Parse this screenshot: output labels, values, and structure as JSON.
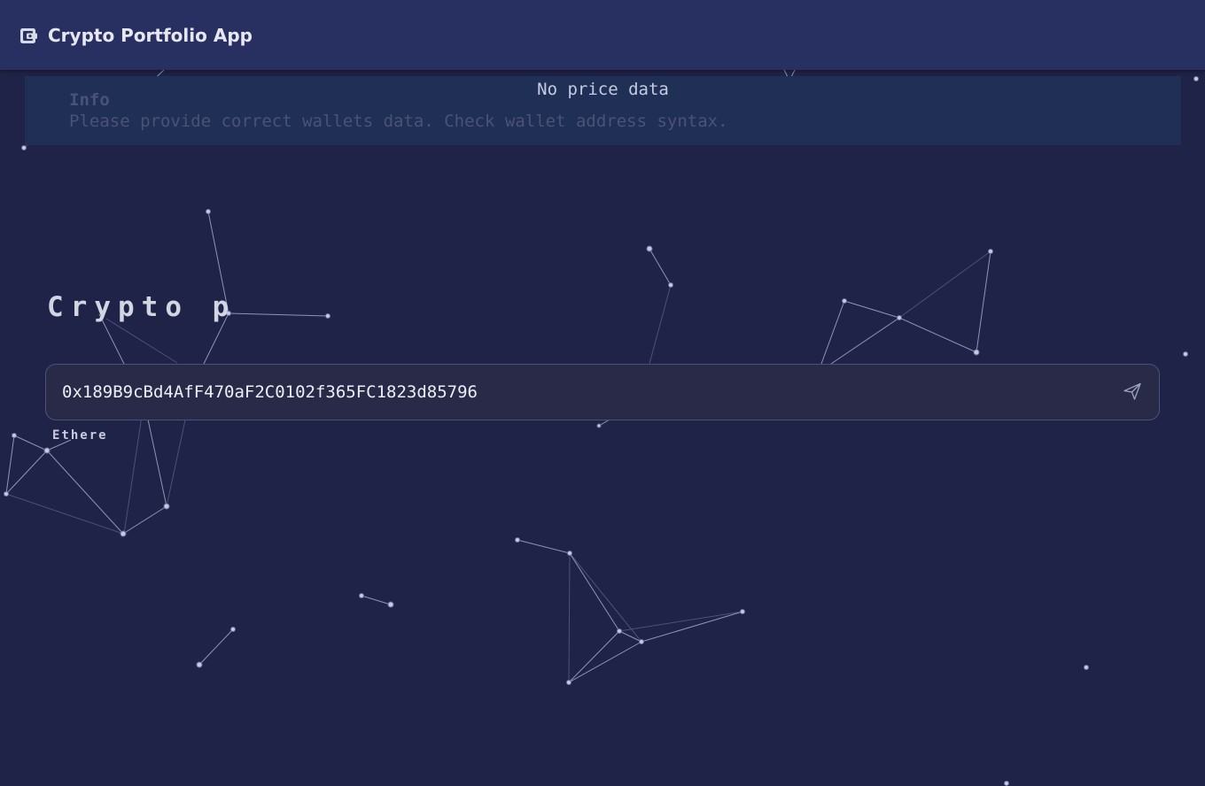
{
  "app_bar": {
    "icon": "wallet-icon",
    "title": "Crypto Portfolio App"
  },
  "alert": {
    "status": "No price data",
    "title": "Info",
    "message": "Please provide correct wallets data. Check wallet address syntax."
  },
  "hero": {
    "title": "Crypto p"
  },
  "address_input": {
    "value": "0x189B9cBd4AfF470aF2C0102f365FC1823d85796",
    "submit_icon": "send-icon"
  },
  "chain_label": "Ethere",
  "colors": {
    "background": "#1f2347",
    "app_bar": "#283062",
    "alert_background": "#1f2f55",
    "input_background": "#282a47"
  }
}
